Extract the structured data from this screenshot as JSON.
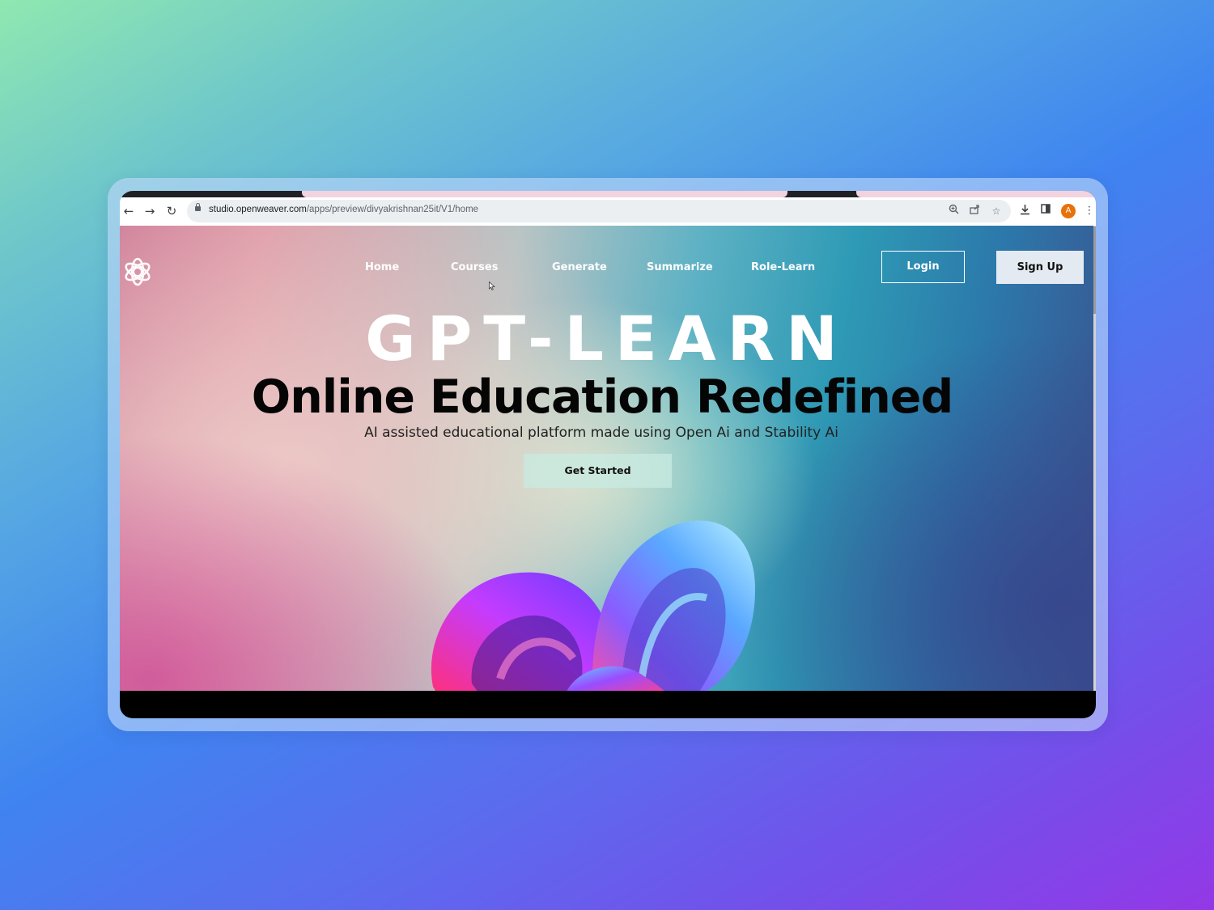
{
  "browser": {
    "url_host": "studio.openweaver.com",
    "url_path": "/apps/preview/divyakrishnan25it/V1/home",
    "profile_initial": "A"
  },
  "site": {
    "nav": [
      {
        "label": "Home"
      },
      {
        "label": "Courses"
      },
      {
        "label": "Generate"
      },
      {
        "label": "Summarize"
      },
      {
        "label": "Role-Learn"
      }
    ],
    "login_label": "Login",
    "signup_label": "Sign Up",
    "brand": "GPT-LEARN",
    "headline": "Online Education Redefined",
    "subheadline": "AI assisted educational platform made using Open Ai and Stability Ai",
    "cta_label": "Get Started"
  },
  "colors": {
    "avatar": "#e8710a",
    "signup_bg": "#e4eaf1",
    "headline": "#050505"
  },
  "icons": {
    "logo": "openai-knot-icon",
    "back": "arrow-left-icon",
    "forward": "arrow-right-icon",
    "reload": "reload-icon",
    "zoom": "zoom-icon",
    "share": "share-icon",
    "bookmark": "star-icon",
    "download": "download-icon",
    "sidepanel": "side-panel-icon",
    "menu": "kebab-menu-icon"
  }
}
